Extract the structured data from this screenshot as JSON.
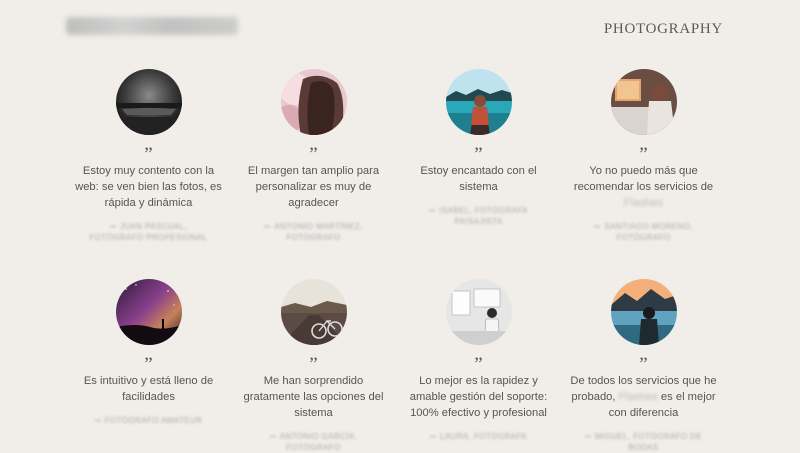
{
  "header": {
    "logo_label": "",
    "brand": "PHOTOGRAPHY"
  },
  "testimonials": [
    {
      "quote_mark": "”",
      "text": "Estoy muy contento con la web: se ven bien las fotos, es rápida y dinámica",
      "author": "JUAN PASCUAL, FOTÓGRAFO PROFESIONAL",
      "photo_icon": "night-pier-photo"
    },
    {
      "quote_mark": "”",
      "text": "El margen tan amplio para personalizar es muy de agradecer",
      "author": "ANTONIO MARTÍNEZ, FOTÓGRAFO",
      "photo_icon": "portrait-hair-photo"
    },
    {
      "quote_mark": "”",
      "text": "Estoy encantado con el sistema",
      "author": "ISABEL, FOTÓGRAFA PAISAJISTA",
      "photo_icon": "lake-woman-photo"
    },
    {
      "quote_mark": "”",
      "text": "Yo no puedo más que recomendar los servicios de",
      "text_blurred": "Flashes",
      "author": "SANTIAGO MORENO, FOTÓGRAFO",
      "photo_icon": "bedroom-photo"
    },
    {
      "quote_mark": "”",
      "text": "Es intuitivo y está lleno de facilidades",
      "author": "FOTÓGRAFO AMATEUR",
      "photo_icon": "milky-way-photo"
    },
    {
      "quote_mark": "”",
      "text": "Me han sorprendido gratamente las opciones del sistema",
      "author": "ANTONIO GARCÍA, FOTÓGRAFO",
      "photo_icon": "bicycle-road-photo"
    },
    {
      "quote_mark": "”",
      "text": "Lo mejor es la rapidez y amable gestión del soporte: 100% efectivo y profesional",
      "author": "LAURA, FOTÓGRAFA",
      "photo_icon": "gallery-photo"
    },
    {
      "quote_mark": "”",
      "text": "De todos los servicios que he probado,",
      "text_blurred": "Flashes",
      "text_after": "es el mejor con diferencia",
      "author": "MIGUEL, FOTÓGRAFO DE BODAS",
      "photo_icon": "mountain-lake-photo"
    }
  ]
}
